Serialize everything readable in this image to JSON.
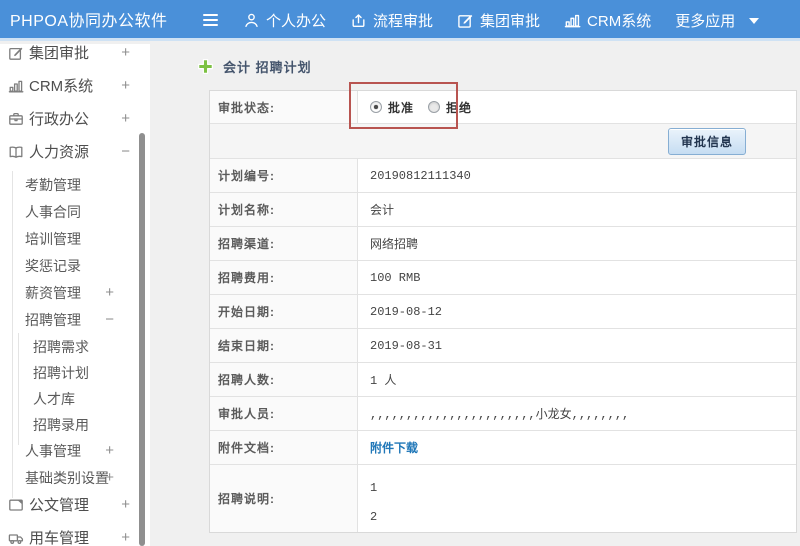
{
  "colors": {
    "navbar_blue": "#4a90d9",
    "navbar_bottom_strip": "#cfe2f4",
    "content_background": "#f0f0f0",
    "table_border": "#d9d9d9",
    "link_blue": "#2077b8",
    "annotation_red": "#b85450",
    "plus_green": "#7cc142",
    "button_face": "#c6ddf2",
    "button_border": "#86aed3"
  },
  "topnav": {
    "brand": "PHPOA协同办公软件",
    "items": [
      {
        "label": "个人办公",
        "icon": "user-icon"
      },
      {
        "label": "流程审批",
        "icon": "flow-icon"
      },
      {
        "label": "集团审批",
        "icon": "edit-icon"
      },
      {
        "label": "CRM系统",
        "icon": "chart-icon"
      },
      {
        "label": "更多应用",
        "icon": "caret-down-icon",
        "caret": true
      }
    ]
  },
  "sidebar": {
    "items": [
      {
        "label": "集团审批",
        "icon": "edit-icon",
        "level": 0,
        "toggle": "+"
      },
      {
        "label": "CRM系统",
        "icon": "chart-icon",
        "level": 0,
        "toggle": "+"
      },
      {
        "label": "行政办公",
        "icon": "briefcase-icon",
        "level": 0,
        "toggle": "+"
      },
      {
        "label": "人力资源",
        "icon": "book-icon",
        "level": 0,
        "toggle": "−"
      },
      {
        "label": "考勤管理",
        "level": 1,
        "toggle": ""
      },
      {
        "label": "人事合同",
        "level": 1,
        "toggle": ""
      },
      {
        "label": "培训管理",
        "level": 1,
        "toggle": ""
      },
      {
        "label": "奖惩记录",
        "level": 1,
        "toggle": ""
      },
      {
        "label": "薪资管理",
        "level": 1,
        "toggle": "+"
      },
      {
        "label": "招聘管理",
        "level": 1,
        "toggle": "−"
      },
      {
        "label": "招聘需求",
        "level": 2,
        "toggle": ""
      },
      {
        "label": "招聘计划",
        "level": 2,
        "toggle": ""
      },
      {
        "label": "人才库",
        "level": 2,
        "toggle": ""
      },
      {
        "label": "招聘录用",
        "level": 2,
        "toggle": ""
      },
      {
        "label": "人事管理",
        "level": 1,
        "toggle": "+"
      },
      {
        "label": "基础类别设置",
        "level": 1,
        "toggle": "+"
      },
      {
        "label": "公文管理",
        "icon": "doc-icon",
        "level": 0,
        "toggle": "+"
      },
      {
        "label": "用车管理",
        "icon": "car-icon",
        "level": 0,
        "toggle": "+"
      }
    ]
  },
  "main": {
    "title": "会计 招聘计划",
    "approval_status": {
      "label": "审批状态:",
      "options": [
        {
          "label": "批准",
          "selected": true
        },
        {
          "label": "拒绝",
          "selected": false
        }
      ]
    },
    "button_label": "审批信息",
    "rows": [
      {
        "label": "计划编号:",
        "value": "20190812111340",
        "type": "text"
      },
      {
        "label": "计划名称:",
        "value": "会计",
        "type": "text"
      },
      {
        "label": "招聘渠道:",
        "value": "网络招聘",
        "type": "text"
      },
      {
        "label": "招聘费用:",
        "value": "100 RMB",
        "type": "text"
      },
      {
        "label": "开始日期:",
        "value": "2019-08-12",
        "type": "text"
      },
      {
        "label": "结束日期:",
        "value": "2019-08-31",
        "type": "text"
      },
      {
        "label": "招聘人数:",
        "value": "1 人",
        "type": "text"
      },
      {
        "label": "审批人员:",
        "value": ",,,,,,,,,,,,,,,,,,,,,,,小龙女,,,,,,,,",
        "type": "text"
      },
      {
        "label": "附件文档:",
        "value": "附件下载",
        "type": "link"
      },
      {
        "label": "招聘说明:",
        "lines": [
          "1",
          "2"
        ],
        "type": "multiline"
      }
    ]
  }
}
